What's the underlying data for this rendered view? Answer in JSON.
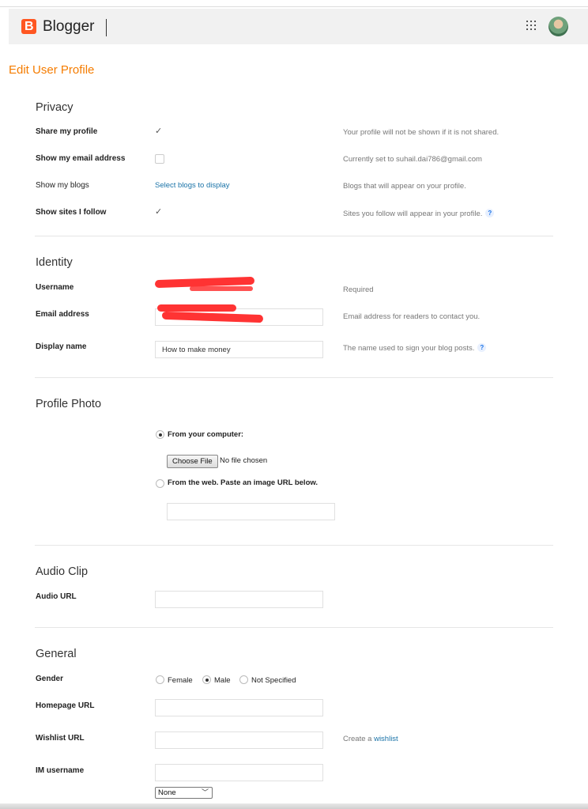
{
  "header": {
    "logo_letter": "B",
    "brand": "Blogger",
    "apps_icon": "apps-grid-icon",
    "avatar_icon": "avatar-icon"
  },
  "page": {
    "title": "Edit User Profile"
  },
  "privacy": {
    "title": "Privacy",
    "share_profile": {
      "label": "Share my profile",
      "checked": true,
      "hint": "Your profile will not be shown if it is not shared."
    },
    "show_email": {
      "label": "Show my email address",
      "checked": false,
      "hint": "Currently set to suhail.dai786@gmail.com"
    },
    "show_blogs": {
      "label": "Show my blogs",
      "link": "Select blogs to display",
      "hint": "Blogs that will appear on your profile."
    },
    "show_sites": {
      "label": "Show sites I follow",
      "checked": true,
      "hint": "Sites you follow will appear in your profile."
    }
  },
  "identity": {
    "title": "Identity",
    "username": {
      "label": "Username",
      "hint": "Required"
    },
    "email": {
      "label": "Email address",
      "hint": "Email address for readers to contact you."
    },
    "display_name": {
      "label": "Display name",
      "value": "How to make money",
      "hint": "The name used to sign your blog posts."
    }
  },
  "profile_photo": {
    "title": "Profile Photo",
    "from_computer": "From your computer:",
    "choose_file": "Choose File",
    "no_file": "No file chosen",
    "from_web": "From the web. Paste an image URL below.",
    "selected": "computer"
  },
  "audio": {
    "title": "Audio Clip",
    "url_label": "Audio URL"
  },
  "general": {
    "title": "General",
    "gender_label": "Gender",
    "gender_options": [
      "Female",
      "Male",
      "Not Specified"
    ],
    "gender_selected": "Male",
    "homepage_label": "Homepage URL",
    "wishlist_label": "Wishlist URL",
    "wishlist_hint_prefix": "Create a",
    "wishlist_hint_link": "wishlist",
    "im_label": "IM username",
    "im_select_value": "None"
  },
  "colors": {
    "accent": "#f57c00",
    "link": "#1a73a8",
    "logo": "#ff5722",
    "redaction": "#ff3333"
  }
}
